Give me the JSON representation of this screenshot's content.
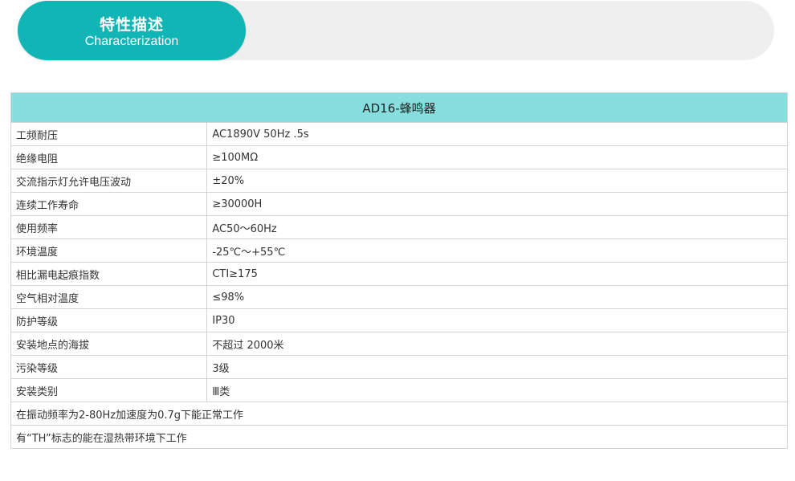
{
  "header": {
    "title": "特性描述",
    "subtitle": "Characterization"
  },
  "table": {
    "title": "AD16-蜂鸣器",
    "rows": [
      {
        "label": "工频耐压",
        "value": "AC1890V 50Hz .5s"
      },
      {
        "label": "绝缘电阻",
        "value": "≥100MΩ"
      },
      {
        "label": "交流指示灯允许电压波动",
        "value": "±20%"
      },
      {
        "label": "连续工作寿命",
        "value": "≥30000H"
      },
      {
        "label": "使用频率",
        "value": "AC50～60Hz"
      },
      {
        "label": "环境温度",
        "value": "-25℃～+55℃"
      },
      {
        "label": "相比漏电起痕指数",
        "value": "CTI≥175"
      },
      {
        "label": "空气相对温度",
        "value": "≤98%"
      },
      {
        "label": "防护等级",
        "value": "IP30"
      },
      {
        "label": "安装地点的海拔",
        "value": "不超过 2000米"
      },
      {
        "label": "污染等级",
        "value": "3级"
      },
      {
        "label": "安装类别",
        "value": "Ⅲ类"
      }
    ],
    "notes": [
      "在振动频率为2-80Hz加速度为0.7g下能正常工作",
      "有“TH”标志的能在湿热带环境下工作"
    ]
  },
  "colors": {
    "accent": "#12b5b5",
    "table_header": "#86dede",
    "header_bar": "#efefef"
  }
}
